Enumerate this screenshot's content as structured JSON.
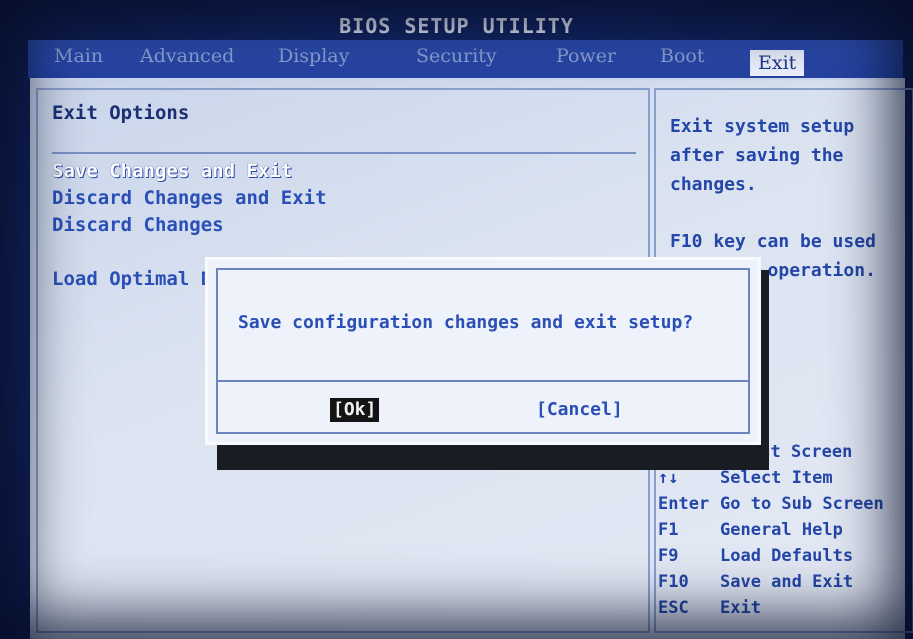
{
  "window": {
    "title": "BIOS SETUP UTILITY"
  },
  "menu": [
    {
      "label": "Main",
      "active": false
    },
    {
      "label": "Advanced",
      "active": false
    },
    {
      "label": "Display",
      "active": false
    },
    {
      "label": "Security",
      "active": false
    },
    {
      "label": "Power",
      "active": false
    },
    {
      "label": "Boot",
      "active": false
    },
    {
      "label": "Exit",
      "active": true
    }
  ],
  "left_panel": {
    "section_title": "Exit Options",
    "options": [
      {
        "label": "Save Changes and Exit",
        "selected": true
      },
      {
        "label": "Discard Changes and Exit",
        "selected": false
      },
      {
        "label": "Discard Changes",
        "selected": false
      },
      {
        "label": "Load Optimal D",
        "selected": false
      }
    ]
  },
  "right_panel": {
    "help": [
      "Exit system setup after saving the changes.",
      "F10 key can be used for this operation."
    ],
    "keys": [
      {
        "key": "",
        "desc": "ect Screen"
      },
      {
        "key": "↑↓",
        "desc": "Select Item"
      },
      {
        "key": "Enter",
        "desc": "Go to Sub Screen"
      },
      {
        "key": "F1",
        "desc": "General Help"
      },
      {
        "key": "F9",
        "desc": "Load Defaults"
      },
      {
        "key": "F10",
        "desc": "Save and Exit"
      },
      {
        "key": "ESC",
        "desc": "Exit"
      }
    ]
  },
  "dialog": {
    "message": "Save configuration changes and exit setup?",
    "ok_label": "[Ok]",
    "cancel_label": "[Cancel]"
  },
  "colors": {
    "background": "#14286b",
    "panel": "#dbe3f1",
    "text": "#2a4fb6",
    "highlight": "#ffffff"
  }
}
